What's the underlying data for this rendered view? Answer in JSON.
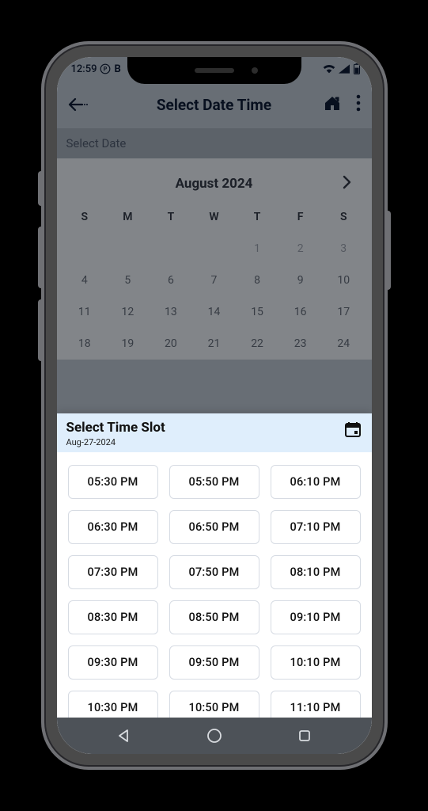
{
  "status": {
    "time": "12:59",
    "icons_left": [
      "p-icon",
      "b-icon"
    ],
    "icons_right": [
      "wifi-icon",
      "signal-icon",
      "battery-icon"
    ]
  },
  "header": {
    "title": "Select Date Time",
    "back_icon": "back-icon",
    "home_icon": "home-icon",
    "more_icon": "more-vert-icon"
  },
  "section": {
    "label": "Select Date"
  },
  "calendar": {
    "month_label": "August 2024",
    "next_icon": "chevron-right-icon",
    "dow": [
      "S",
      "M",
      "T",
      "W",
      "T",
      "F",
      "S"
    ],
    "rows": [
      [
        "",
        "",
        "",
        "",
        "1",
        "2",
        "3"
      ],
      [
        "4",
        "5",
        "6",
        "7",
        "8",
        "9",
        "10"
      ],
      [
        "11",
        "12",
        "13",
        "14",
        "15",
        "16",
        "17"
      ],
      [
        "18",
        "19",
        "20",
        "21",
        "22",
        "23",
        "24"
      ]
    ]
  },
  "sheet": {
    "title": "Select Time Slot",
    "subtitle": "Aug-27-2024",
    "calendar_icon": "calendar-icon",
    "slots": [
      "05:30 PM",
      "05:50 PM",
      "06:10 PM",
      "06:30 PM",
      "06:50 PM",
      "07:10 PM",
      "07:30 PM",
      "07:50 PM",
      "08:10 PM",
      "08:30 PM",
      "08:50 PM",
      "09:10 PM",
      "09:30 PM",
      "09:50 PM",
      "10:10 PM",
      "10:30 PM",
      "10:50 PM",
      "11:10 PM"
    ]
  },
  "navbar": {
    "back": "nav-back-icon",
    "home": "nav-home-icon",
    "recent": "nav-recent-icon"
  }
}
